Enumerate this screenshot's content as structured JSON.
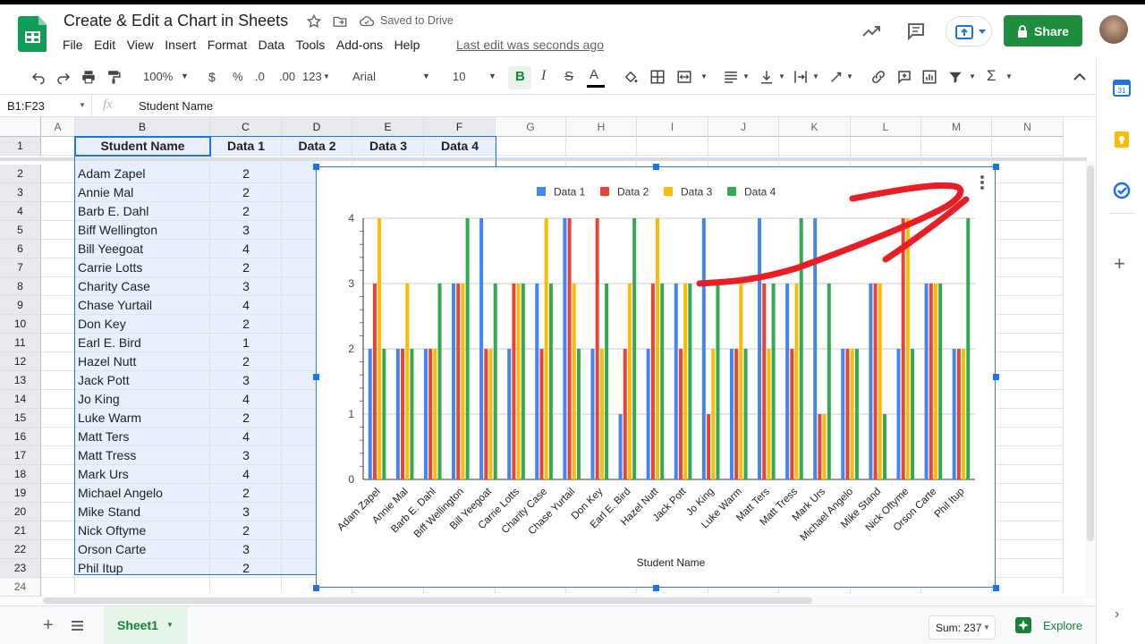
{
  "doc": {
    "title": "Create & Edit a Chart in Sheets",
    "saved_status": "Saved to Drive"
  },
  "menu": [
    "File",
    "Edit",
    "View",
    "Insert",
    "Format",
    "Data",
    "Tools",
    "Add-ons",
    "Help"
  ],
  "last_edit": "Last edit was seconds ago",
  "share_label": "Share",
  "toolbar": {
    "zoom": "100%",
    "currency": "$",
    "percent": "%",
    "dec_less": ".0",
    "dec_more": ".00",
    "format": "123",
    "font": "Arial",
    "font_size": "10"
  },
  "formula_bar": {
    "name_box": "B1:F23",
    "fx": "fx",
    "content": "Student Name"
  },
  "columns": [
    "A",
    "B",
    "C",
    "D",
    "E",
    "F",
    "G",
    "H",
    "I",
    "J",
    "K",
    "L",
    "M",
    "N"
  ],
  "headers": [
    "Student Name",
    "Data 1",
    "Data 2",
    "Data 3",
    "Data 4"
  ],
  "rows": [
    {
      "name": "Adam Zapel",
      "d1": "2"
    },
    {
      "name": "Annie Mal",
      "d1": "2"
    },
    {
      "name": "Barb E. Dahl",
      "d1": "2"
    },
    {
      "name": "Biff Wellington",
      "d1": "3"
    },
    {
      "name": "Bill Yeegoat",
      "d1": "4"
    },
    {
      "name": "Carrie Lotts",
      "d1": "2"
    },
    {
      "name": "Charity Case",
      "d1": "3"
    },
    {
      "name": "Chase Yurtail",
      "d1": "4"
    },
    {
      "name": "Don Key",
      "d1": "2"
    },
    {
      "name": "Earl E. Bird",
      "d1": "1"
    },
    {
      "name": "Hazel Nutt",
      "d1": "2"
    },
    {
      "name": "Jack Pott",
      "d1": "3"
    },
    {
      "name": "Jo King",
      "d1": "4"
    },
    {
      "name": "Luke Warm",
      "d1": "2"
    },
    {
      "name": "Matt Ters",
      "d1": "4"
    },
    {
      "name": "Matt Tress",
      "d1": "3"
    },
    {
      "name": "Mark Urs",
      "d1": "4"
    },
    {
      "name": "Michael Angelo",
      "d1": "2"
    },
    {
      "name": "Mike Stand",
      "d1": "3"
    },
    {
      "name": "Nick Oftyme",
      "d1": "2"
    },
    {
      "name": "Orson Carte",
      "d1": "3"
    },
    {
      "name": "Phil Itup",
      "d1": "2"
    }
  ],
  "row_numbers": [
    "1",
    "2",
    "3",
    "4",
    "5",
    "6",
    "7",
    "8",
    "9",
    "10",
    "11",
    "12",
    "13",
    "14",
    "15",
    "16",
    "17",
    "18",
    "19",
    "20",
    "21",
    "22",
    "23",
    "24"
  ],
  "bottom": {
    "sheet": "Sheet1",
    "sum": "Sum: 237",
    "explore": "Explore"
  },
  "colors": {
    "data1": "#4285f4",
    "data2": "#ea4335",
    "data3": "#fbbc04",
    "data4": "#34a853",
    "share": "#1e8e3e",
    "selection": "#1a73e8",
    "annotation": "#ea1c24"
  },
  "chart_data": {
    "type": "bar",
    "xlabel": "Student Name",
    "ylim": [
      0,
      4
    ],
    "yticks": [
      0,
      1,
      2,
      3,
      4
    ],
    "legend": "top",
    "grid": true,
    "categories": [
      "Adam Zapel",
      "Annie Mal",
      "Barb E. Dahl",
      "Biff Wellington",
      "Bill Yeegoat",
      "Carrie Lotts",
      "Charity Case",
      "Chase Yurtail",
      "Don Key",
      "Earl E. Bird",
      "Hazel Nutt",
      "Jack Pott",
      "Jo King",
      "Luke Warm",
      "Matt Ters",
      "Matt Tress",
      "Mark Urs",
      "Michael Angelo",
      "Mike Stand",
      "Nick Oftyme",
      "Orson Carte",
      "Phil Itup"
    ],
    "series": [
      {
        "name": "Data 1",
        "values": [
          2,
          2,
          2,
          3,
          4,
          2,
          3,
          4,
          2,
          1,
          2,
          3,
          4,
          2,
          4,
          3,
          4,
          2,
          3,
          2,
          3,
          2
        ]
      },
      {
        "name": "Data 2",
        "values": [
          3,
          2,
          2,
          3,
          2,
          3,
          2,
          4,
          4,
          2,
          3,
          2,
          1,
          2,
          3,
          2,
          1,
          2,
          3,
          4,
          3,
          2
        ]
      },
      {
        "name": "Data 3",
        "values": [
          4,
          3,
          2,
          3,
          2,
          3,
          4,
          3,
          2,
          3,
          4,
          3,
          2,
          3,
          2,
          3,
          1,
          2,
          3,
          4,
          3,
          2
        ]
      },
      {
        "name": "Data 4",
        "values": [
          2,
          2,
          3,
          4,
          3,
          3,
          3,
          2,
          3,
          4,
          3,
          3,
          3,
          2,
          3,
          4,
          3,
          2,
          1,
          2,
          3,
          4
        ]
      }
    ]
  }
}
